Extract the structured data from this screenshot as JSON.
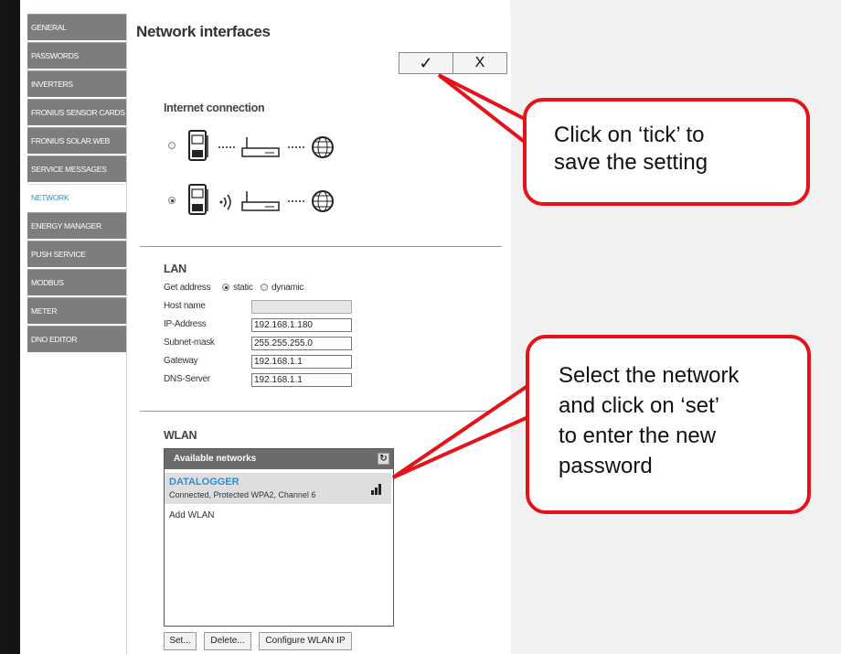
{
  "sidebar": {
    "items": [
      {
        "label": "GENERAL",
        "icon": ""
      },
      {
        "label": "PASSWORDS"
      },
      {
        "label": "INVERTERS"
      },
      {
        "label": "FRONIUS SENSOR CARDS"
      },
      {
        "label": "FRONIUS SOLAR.WEB"
      },
      {
        "label": "SERVICE MESSAGES"
      },
      {
        "label": "NETWORK"
      },
      {
        "label": "ENERGY MANAGER"
      },
      {
        "label": "PUSH SERVICE"
      },
      {
        "label": "MODBUS"
      },
      {
        "label": "METER"
      },
      {
        "label": "DNO EDITOR"
      }
    ],
    "active_index": 6
  },
  "main": {
    "title": "Network interfaces",
    "confirm_symbol": "✓",
    "cancel_symbol": "X"
  },
  "internet": {
    "title": "Internet connection",
    "options": [
      {
        "type": "lan",
        "selected": false
      },
      {
        "type": "wlan",
        "selected": true
      }
    ]
  },
  "lan": {
    "title": "LAN",
    "get_address_label": "Get address",
    "static_label": "static",
    "dynamic_label": "dynamic",
    "address_mode": "static",
    "fields": [
      {
        "label": "Host name",
        "value": "",
        "disabled": true
      },
      {
        "label": "IP-Address",
        "value": "192.168.1.180"
      },
      {
        "label": "Subnet-mask",
        "value": "255.255.255.0"
      },
      {
        "label": "Gateway",
        "value": "192.168.1.1"
      },
      {
        "label": "DNS-Server",
        "value": "192.168.1.1"
      }
    ]
  },
  "wlan": {
    "title": "WLAN",
    "list_header": "Available networks",
    "refresh_icon": "refresh-icon",
    "network": {
      "name": "DATALOGGER",
      "status": "Connected, Protected WPA2, Channel 6"
    },
    "add_label": "Add WLAN",
    "buttons": {
      "set": "Set...",
      "delete": "Delete...",
      "configure": "Configure WLAN IP"
    }
  },
  "callouts": {
    "tick": "Click on ‘tick’ to save the setting",
    "tick_lines": [
      "Click on ‘tick’ to",
      "save the setting"
    ],
    "set_lines": [
      "Select the network",
      "and click on ‘set’",
      "to enter the new",
      "password"
    ]
  },
  "colors": {
    "accent": "#2a8fd8",
    "callout_border": "#e5121a",
    "nav_bg": "#7d7d7d"
  }
}
